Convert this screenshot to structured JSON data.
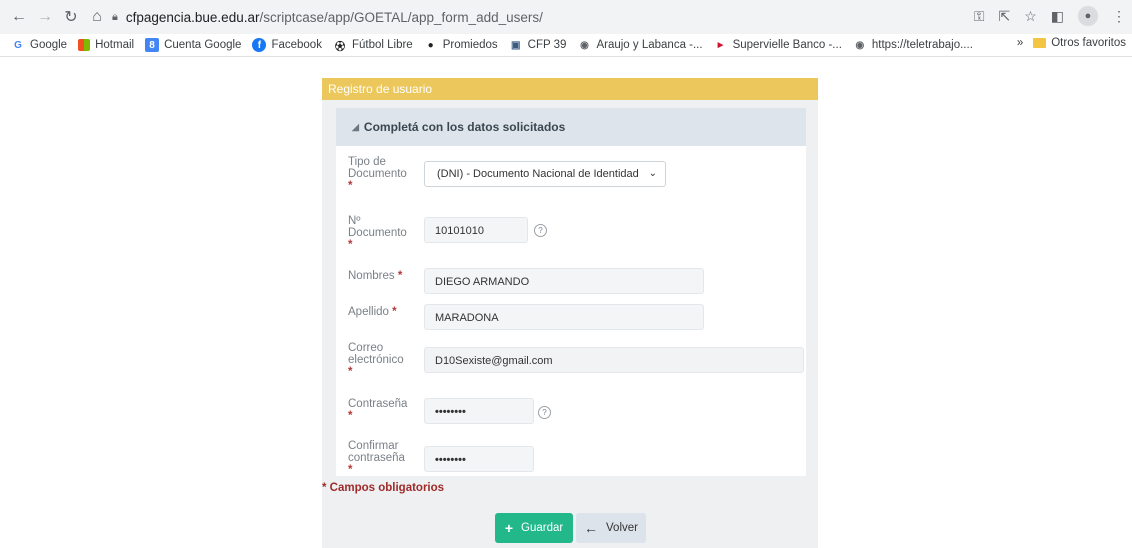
{
  "browser": {
    "url_host": "cfpagencia.bue.edu.ar",
    "url_path": "/scriptcase/app/GOETAL/app_form_add_users/",
    "icons": {
      "back": "arrow-left-icon",
      "forward": "arrow-right-icon",
      "reload": "reload-icon",
      "home": "home-icon",
      "lock": "lock-icon",
      "key": "key-icon",
      "share": "share-icon",
      "star": "star-icon",
      "sidepanel": "side-panel-icon",
      "profile": "profile-icon",
      "menu": "kebab-menu-icon"
    }
  },
  "bookmarks": {
    "items": [
      {
        "label": "Google",
        "icon": "G",
        "color": "#4285f4"
      },
      {
        "label": "Hotmail",
        "icon": "■",
        "color": "#f25022"
      },
      {
        "label": "Cuenta Google",
        "icon": "8",
        "color": "#4285f4"
      },
      {
        "label": "Facebook",
        "icon": "f",
        "color": "#1877f2"
      },
      {
        "label": "Fútbol Libre",
        "icon": "●",
        "color": "#222222"
      },
      {
        "label": "Promiedos",
        "icon": "●",
        "color": "#222222"
      },
      {
        "label": "CFP 39",
        "icon": "▣",
        "color": "#3a5a80"
      },
      {
        "label": "Araujo y Labanca -...",
        "icon": "◉",
        "color": "#5f6368"
      },
      {
        "label": "Supervielle Banco -...",
        "icon": "►",
        "color": "#d0112b"
      },
      {
        "label": "https://teletrabajo....",
        "icon": "◉",
        "color": "#5f6368"
      }
    ],
    "overflow": "»",
    "other_folder": "Otros favoritos"
  },
  "form": {
    "header": "Registro de usuario",
    "section_title": "Completá con los datos solicitados",
    "required_mark": "*",
    "fields": {
      "tipo_doc": {
        "label": "Tipo de Documento",
        "value": "(DNI) - Documento Nacional de Identidad"
      },
      "nro_doc": {
        "label": "Nº Documento",
        "value": "10101010"
      },
      "nombres": {
        "label": "Nombres",
        "value": "DIEGO ARMANDO"
      },
      "apellido": {
        "label": "Apellido",
        "value": "MARADONA"
      },
      "correo": {
        "label": "Correo electrónico",
        "value": "D10Sexiste@gmail.com"
      },
      "contrasena": {
        "label": "Contraseña",
        "value": "••••••••"
      },
      "confirmar": {
        "label": "Confirmar contraseña",
        "value": "••••••••"
      }
    },
    "help_glyph": "?",
    "mandatory_note": "* Campos obligatorios",
    "buttons": {
      "save": "Guardar",
      "back": "Volver"
    }
  },
  "colors": {
    "header_bar": "#ecc75c",
    "save_button": "#22b88a",
    "required": "#9e2a2a"
  }
}
